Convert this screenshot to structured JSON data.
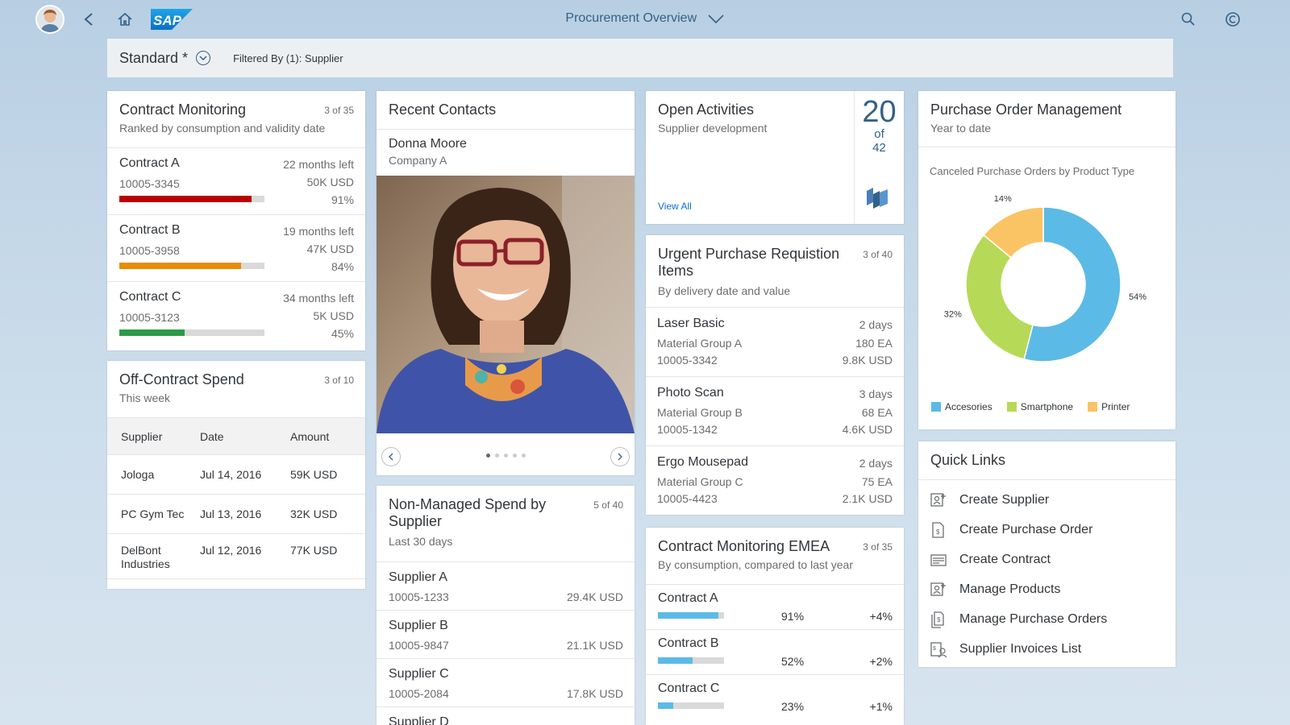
{
  "shell": {
    "title": "Procurement Overview",
    "logo_text": "SAP"
  },
  "filterbar": {
    "variant": "Standard *",
    "filtered_by": "Filtered By (1): Supplier"
  },
  "contract_monitoring": {
    "title": "Contract Monitoring",
    "subtitle": "Ranked by consumption and validity date",
    "count": "3 of 35",
    "items": [
      {
        "name": "Contract A",
        "id": "10005-3345",
        "time_left": "22 months left",
        "amount": "50K USD",
        "percent": "91%",
        "value": 0.91,
        "color": "#bb0000"
      },
      {
        "name": "Contract B",
        "id": "10005-3958",
        "time_left": "19 months left",
        "amount": "47K USD",
        "percent": "84%",
        "value": 0.84,
        "color": "#e78c07"
      },
      {
        "name": "Contract C",
        "id": "10005-3123",
        "time_left": "34 months left",
        "amount": "5K USD",
        "percent": "45%",
        "value": 0.45,
        "color": "#2b9a46"
      }
    ]
  },
  "off_contract": {
    "title": "Off-Contract Spend",
    "subtitle": "This week",
    "count": "3 of 10",
    "columns": [
      "Supplier",
      "Date",
      "Amount"
    ],
    "rows": [
      [
        "Jologa",
        "Jul 14, 2016",
        "59K USD"
      ],
      [
        "PC Gym Tec",
        "Jul 13, 2016",
        "32K USD"
      ],
      [
        "DelBont Industries",
        "Jul 12, 2016",
        "77K USD"
      ]
    ]
  },
  "recent_contacts": {
    "title": "Recent Contacts",
    "name": "Donna Moore",
    "company": "Company A",
    "pages": 5,
    "active_page": 1
  },
  "non_managed": {
    "title": "Non-Managed Spend by Supplier",
    "subtitle": "Last 30 days",
    "count": "5 of 40",
    "items": [
      {
        "name": "Supplier A",
        "id": "10005-1233",
        "amount": "29.4K USD"
      },
      {
        "name": "Supplier B",
        "id": "10005-9847",
        "amount": "21.1K USD"
      },
      {
        "name": "Supplier C",
        "id": "10005-2084",
        "amount": "17.8K USD"
      },
      {
        "name": "Supplier D",
        "id": "",
        "amount": ""
      }
    ]
  },
  "open_activities": {
    "title": "Open Activities",
    "subtitle": "Supplier development",
    "big_number": "20",
    "of": "of",
    "total": "42",
    "link": "View All"
  },
  "urgent_pr": {
    "title": "Urgent Purchase Requistion Items",
    "subtitle": "By delivery date and value",
    "count": "3 of 40",
    "items": [
      {
        "name": "Laser Basic",
        "group": "Material Group A",
        "id": "10005-3342",
        "days": "2 days",
        "qty": "180 EA",
        "amount": "9.8K USD"
      },
      {
        "name": "Photo Scan",
        "group": "Material Group B",
        "id": "10005-1342",
        "days": "3 days",
        "qty": "68 EA",
        "amount": "4.6K USD"
      },
      {
        "name": "Ergo Mousepad",
        "group": "Material Group C",
        "id": "10005-4423",
        "days": "2 days",
        "qty": "75 EA",
        "amount": "2.1K USD"
      }
    ]
  },
  "contract_emea": {
    "title": "Contract Monitoring EMEA",
    "subtitle": "By consumption, compared to last year",
    "count": "3 of 35",
    "items": [
      {
        "name": "Contract A",
        "percent": "91%",
        "value": 0.91,
        "delta": "+4%"
      },
      {
        "name": "Contract B",
        "percent": "52%",
        "value": 0.52,
        "delta": "+2%"
      },
      {
        "name": "Contract C",
        "percent": "23%",
        "value": 0.23,
        "delta": "+1%"
      }
    ]
  },
  "po_management": {
    "title": "Purchase Order Management",
    "subtitle": "Year to date",
    "chart_title": "Canceled Purchase Orders by Product Type"
  },
  "chart_data": {
    "type": "pie",
    "title": "Canceled Purchase Orders by Product Type",
    "categories": [
      "Accesories",
      "Smartphone",
      "Printer"
    ],
    "values": [
      54,
      32,
      14
    ],
    "labels": [
      "54%",
      "32%",
      "14%"
    ],
    "colors": [
      "#5cbae6",
      "#b6d957",
      "#fac364"
    ],
    "donut": true,
    "legend": "bottom"
  },
  "quick_links": {
    "title": "Quick Links",
    "items": [
      {
        "label": "Create Supplier",
        "icon": "add-contact-icon"
      },
      {
        "label": "Create Purchase Order",
        "icon": "document-dollar-icon"
      },
      {
        "label": "Create Contract",
        "icon": "card-icon"
      },
      {
        "label": "Manage Products",
        "icon": "add-product-icon"
      },
      {
        "label": "Manage Purchase Orders",
        "icon": "documents-dollar-icon"
      },
      {
        "label": "Supplier Invoices List",
        "icon": "supplier-invoice-icon"
      }
    ]
  }
}
